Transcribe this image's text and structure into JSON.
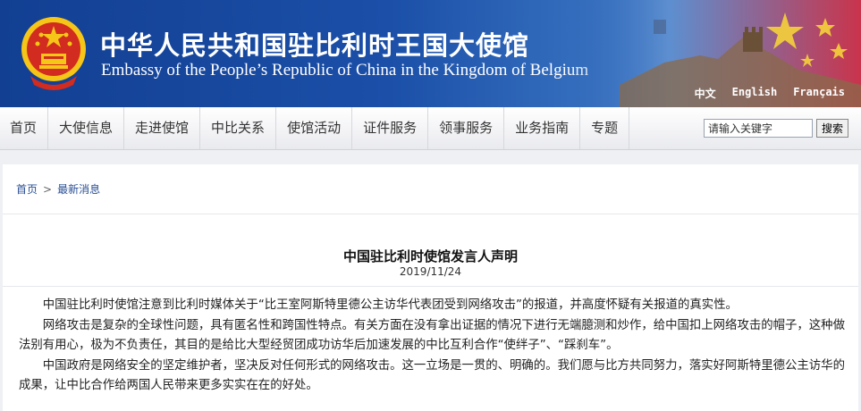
{
  "site": {
    "cn_title": "中华人民共和国驻比利时王国大使馆",
    "en_title": "Embassy of the People’s Republic of China in the Kingdom of Belgium",
    "emblem_icon": "national-emblem-icon",
    "languages": [
      "中文",
      "English",
      "Français"
    ]
  },
  "nav": {
    "items": [
      "首页",
      "大使信息",
      "走进使馆",
      "中比关系",
      "使馆活动",
      "证件服务",
      "领事服务",
      "业务指南",
      "专题"
    ]
  },
  "search": {
    "value": "请输入关键字",
    "button": "搜索"
  },
  "breadcrumb": {
    "home": "首页",
    "separator": ">",
    "current": "最新消息"
  },
  "article": {
    "title": "中国驻比利时使馆发言人声明",
    "date": "2019/11/24",
    "paragraphs": [
      "中国驻比利时使馆注意到比利时媒体关于“比王室阿斯特里德公主访华代表团受到网络攻击”的报道，并高度怀疑有关报道的真实性。",
      "网络攻击是复杂的全球性问题，具有匿名性和跨国性特点。有关方面在没有拿出证据的情况下进行无端臆测和炒作，给中国扣上网络攻击的帽子，这种做法别有用心，极为不负责任，其目的是给比大型经贸团成功访华后加速发展的中比互利合作“使绊子”、“踩刹车”。",
      "中国政府是网络安全的坚定维护者，坚决反对任何形式的网络攻击。这一立场是一贯的、明确的。我们愿与比方共同努力，落实好阿斯特里德公主访华的成果，让中比合作给两国人民带来更多实实在在的好处。"
    ]
  },
  "colors": {
    "banner_blue": "#1b4fa8",
    "emblem_red": "#d22b1f",
    "emblem_gold": "#f5c518",
    "link_blue": "#2a4f95"
  }
}
